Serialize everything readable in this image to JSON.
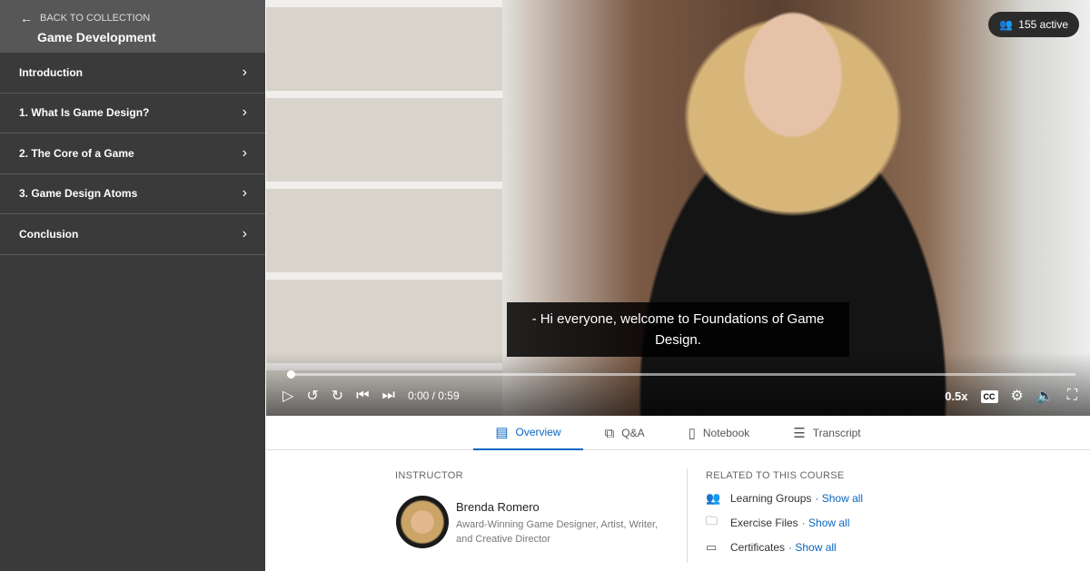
{
  "sidebar": {
    "back_label": "BACK TO COLLECTION",
    "collection": "Game Development",
    "chapters": [
      {
        "label": "Introduction"
      },
      {
        "label": "1. What Is Game Design?"
      },
      {
        "label": "2. The Core of a Game"
      },
      {
        "label": "3. Game Design Atoms"
      },
      {
        "label": "Conclusion"
      }
    ]
  },
  "video": {
    "active": "155 active",
    "caption": "- Hi everyone, welcome to Foundations of Game Design.",
    "time": "0:00 / 0:59",
    "speed": "0.5x",
    "cc": "CC",
    "progress_percent": 0.5
  },
  "tabs": [
    {
      "label": "Overview",
      "icon": "overview-icon"
    },
    {
      "label": "Q&A",
      "icon": "qa-icon"
    },
    {
      "label": "Notebook",
      "icon": "notebook-icon"
    },
    {
      "label": "Transcript",
      "icon": "transcript-icon"
    }
  ],
  "instructor": {
    "label": "INSTRUCTOR",
    "name": "Brenda Romero",
    "title": "Award-Winning Game Designer, Artist, Writer, and Creative Director"
  },
  "related": {
    "label": "RELATED TO THIS COURSE",
    "items": [
      {
        "label": "Learning Groups",
        "link": "· Show all"
      },
      {
        "label": "Exercise Files",
        "link": "· Show all"
      },
      {
        "label": "Certificates",
        "link": "· Show all"
      }
    ]
  },
  "colors": {
    "accent": "#0a66c2",
    "sidebar": "#3a3a3a"
  }
}
